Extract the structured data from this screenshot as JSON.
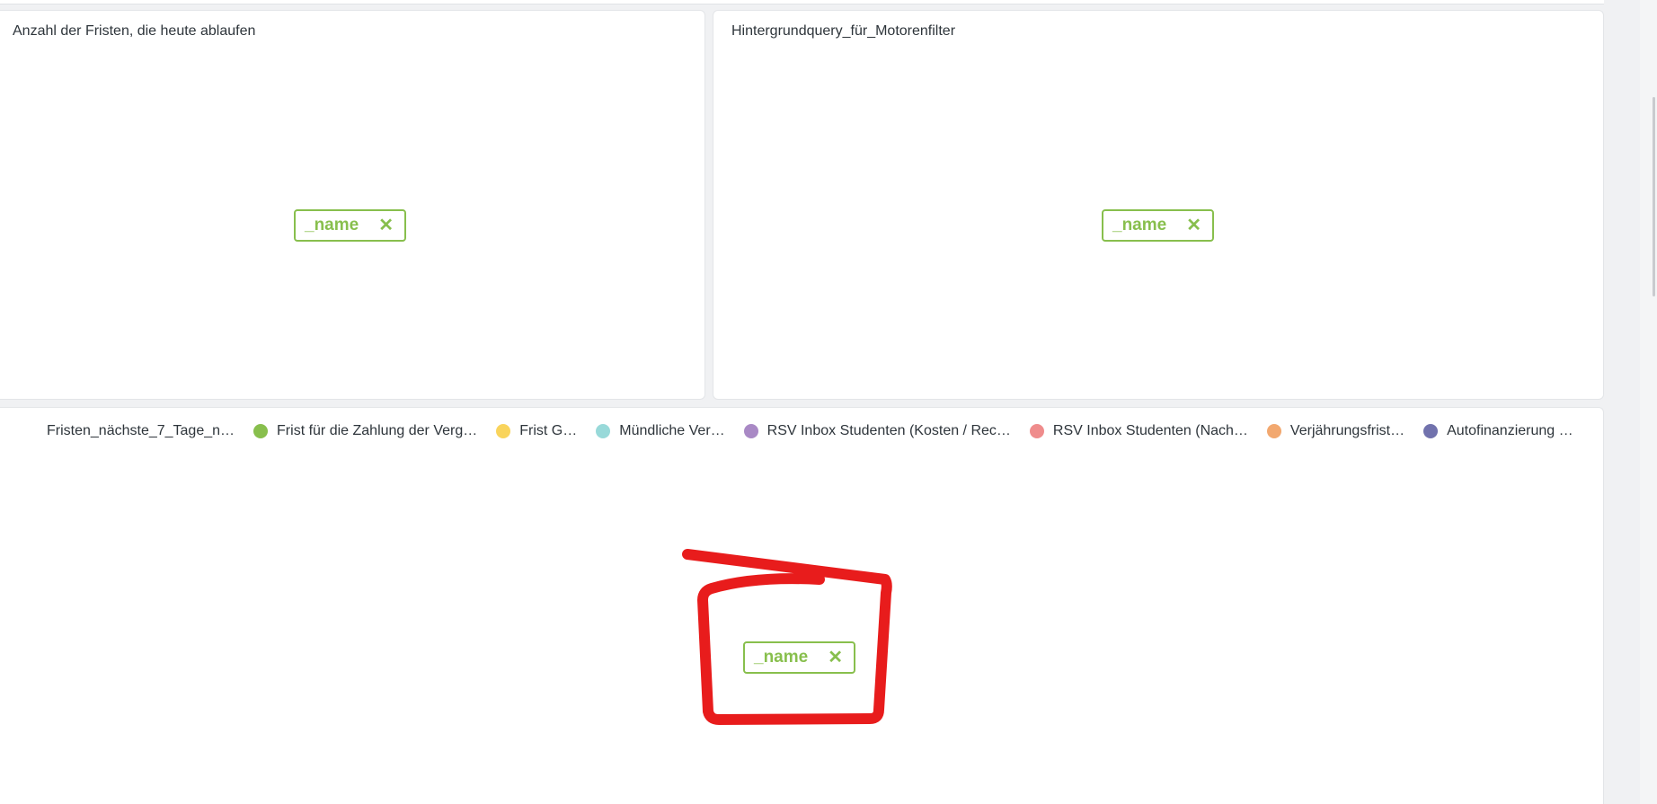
{
  "cards": {
    "left": {
      "title": "Anzahl der Fristen, die heute ablaufen"
    },
    "right": {
      "title": "Hintergrundquery_für_Motorenfilter"
    }
  },
  "chips": {
    "label": "_name",
    "close_icon": "close-icon"
  },
  "legend": {
    "items": [
      {
        "label": "Fristen_nächste_7_Tage_n…",
        "color": ""
      },
      {
        "label": "Frist für die Zahlung der Verg…",
        "color": "#88bf4d"
      },
      {
        "label": "Frist G…",
        "color": "#f9d45c"
      },
      {
        "label": "Mündliche Ver…",
        "color": "#98d9d9"
      },
      {
        "label": "RSV Inbox Studenten (Kosten / Rec…",
        "color": "#a989c5"
      },
      {
        "label": "RSV Inbox Studenten (Nach…",
        "color": "#ef8c8c"
      },
      {
        "label": "Verjährungsfrist…",
        "color": "#f2a86f"
      },
      {
        "label": "Autofinanzierung …",
        "color": "#7172ad"
      }
    ]
  },
  "colors": {
    "accent": "#88bf4d",
    "annotation": "#e81c1c"
  }
}
